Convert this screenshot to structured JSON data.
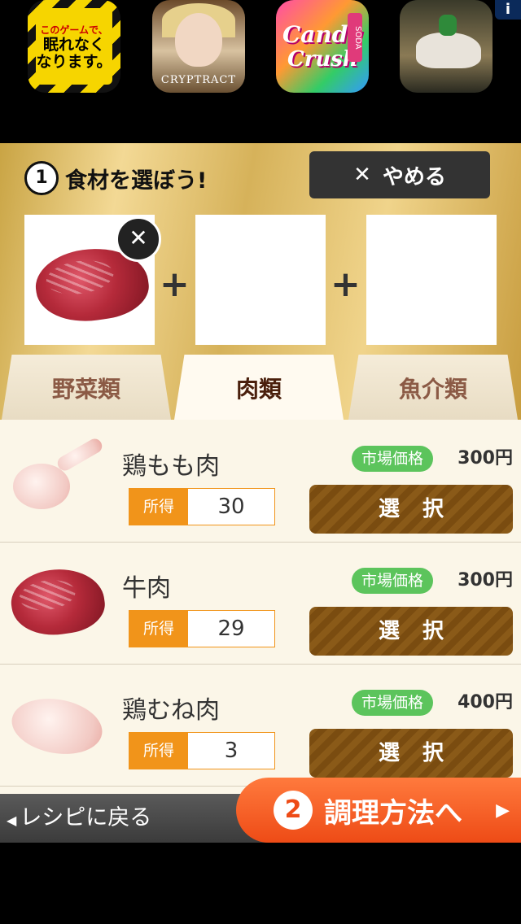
{
  "ads": {
    "ad1_line1": "このゲームで、",
    "ad1_line2": "眠れなく",
    "ad1_line3": "なります。",
    "ad2_title": "CRYPTRACT",
    "ad3_line1": "Candy",
    "ad3_line2": "Crush",
    "ad3_badge": "SODA",
    "info": "i"
  },
  "selection": {
    "step_number": "1",
    "title": "食材を選ぼう!",
    "quit_icon": "✕",
    "quit_label": "やめる",
    "plus": "+",
    "remove_icon": "✕"
  },
  "tabs": [
    {
      "label": "野菜類"
    },
    {
      "label": "肉類"
    },
    {
      "label": "魚介類"
    }
  ],
  "items": [
    {
      "name": "鶏もも肉",
      "market_label": "市場価格",
      "price": "300円",
      "owned_label": "所得",
      "owned": "30",
      "select_label": "選択"
    },
    {
      "name": "牛肉",
      "market_label": "市場価格",
      "price": "300円",
      "owned_label": "所得",
      "owned": "29",
      "select_label": "選択"
    },
    {
      "name": "鶏むね肉",
      "market_label": "市場価格",
      "price": "400円",
      "owned_label": "所得",
      "owned": "3",
      "select_label": "選択"
    }
  ],
  "footer": {
    "back_label": "レシピに戻る",
    "back_icon": "◀",
    "next_number": "2",
    "next_label": "調理方法へ",
    "next_icon": "▶"
  }
}
